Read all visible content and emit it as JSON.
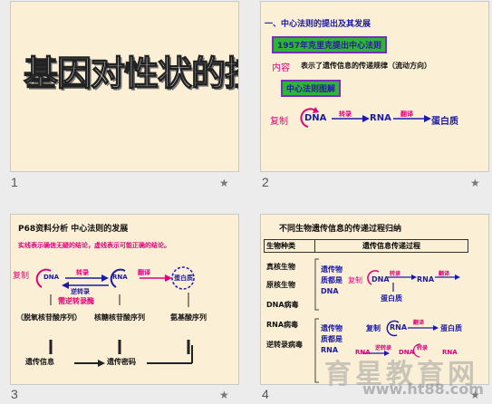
{
  "slides": [
    {
      "number": "1",
      "title": "基因对性状的控制"
    },
    {
      "number": "2",
      "heading": "一、中心法则的提出及其发展",
      "year_box": "1957年克里克提出中心法则",
      "content_label": "内容",
      "content_text": "表示了遗传信息的传递规律（流动方向）",
      "diagram_box": "中心法则图解",
      "replication": "复制",
      "dna": "DNA",
      "transcription": "转录",
      "rna": "RNA",
      "translation": "翻译",
      "protein": "蛋白质"
    },
    {
      "number": "3",
      "heading": "P68资料分析 中心法则的发展",
      "subheading": "实线表示确信无疑的结论，虚线表示可能正确的结论。",
      "replication": "复制",
      "dna": "DNA",
      "rna": "RNA",
      "protein": "蛋白质",
      "transcription": "转录",
      "reverse": "逆转录",
      "reverse_enzyme": "需逆转录酶",
      "translation": "翻译",
      "col1": "（脱氧核苷酸序列）",
      "col2": "核糖核苷酸序列",
      "col3": "氨基酸序列",
      "bottom1": "遗传信息",
      "bottom2": "遗传密码"
    },
    {
      "number": "4",
      "heading": "不同生物遗传信息的传递过程归纳",
      "col_a": "生物种类",
      "col_b": "遗传信息传递过程",
      "row1": "真核生物",
      "row2": "原核生物",
      "row3": "DNA病毒",
      "row4": "RNA病毒",
      "row5": "逆转录病毒",
      "side1": "遗传物质都是DNA",
      "side2": "遗传物质都是RNA",
      "replication": "复制",
      "dna": "DNA",
      "rna": "RNA",
      "transcription": "转录",
      "translation": "翻译",
      "reverse": "逆转录",
      "protein": "蛋白质"
    }
  ],
  "watermark": "育星教育网",
  "watermark_url": "www.ht88.com",
  "star_glyph": "★"
}
